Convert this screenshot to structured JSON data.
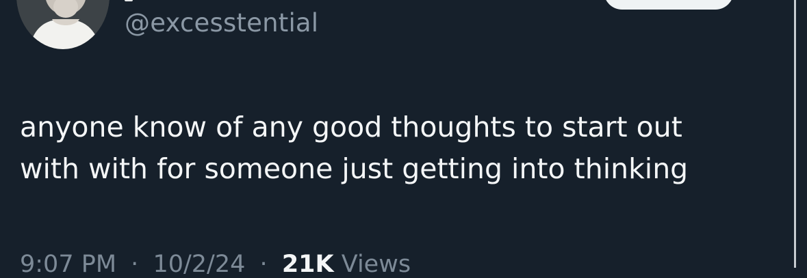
{
  "tweet": {
    "handle": "@excesstential",
    "text_lines": [
      "anyone know of any good thoughts to start out",
      "with with for someone just getting into thinking"
    ],
    "time": "9:07 PM",
    "date": "10/2/24",
    "separator": "·",
    "views_count": "21K",
    "views_label": "Views"
  },
  "colors": {
    "background": "#16202b",
    "handle": "#8b98a5",
    "text": "#f4f6f7",
    "meta": "#7d8a97"
  },
  "icons": {
    "avatar": "profile-photo"
  }
}
